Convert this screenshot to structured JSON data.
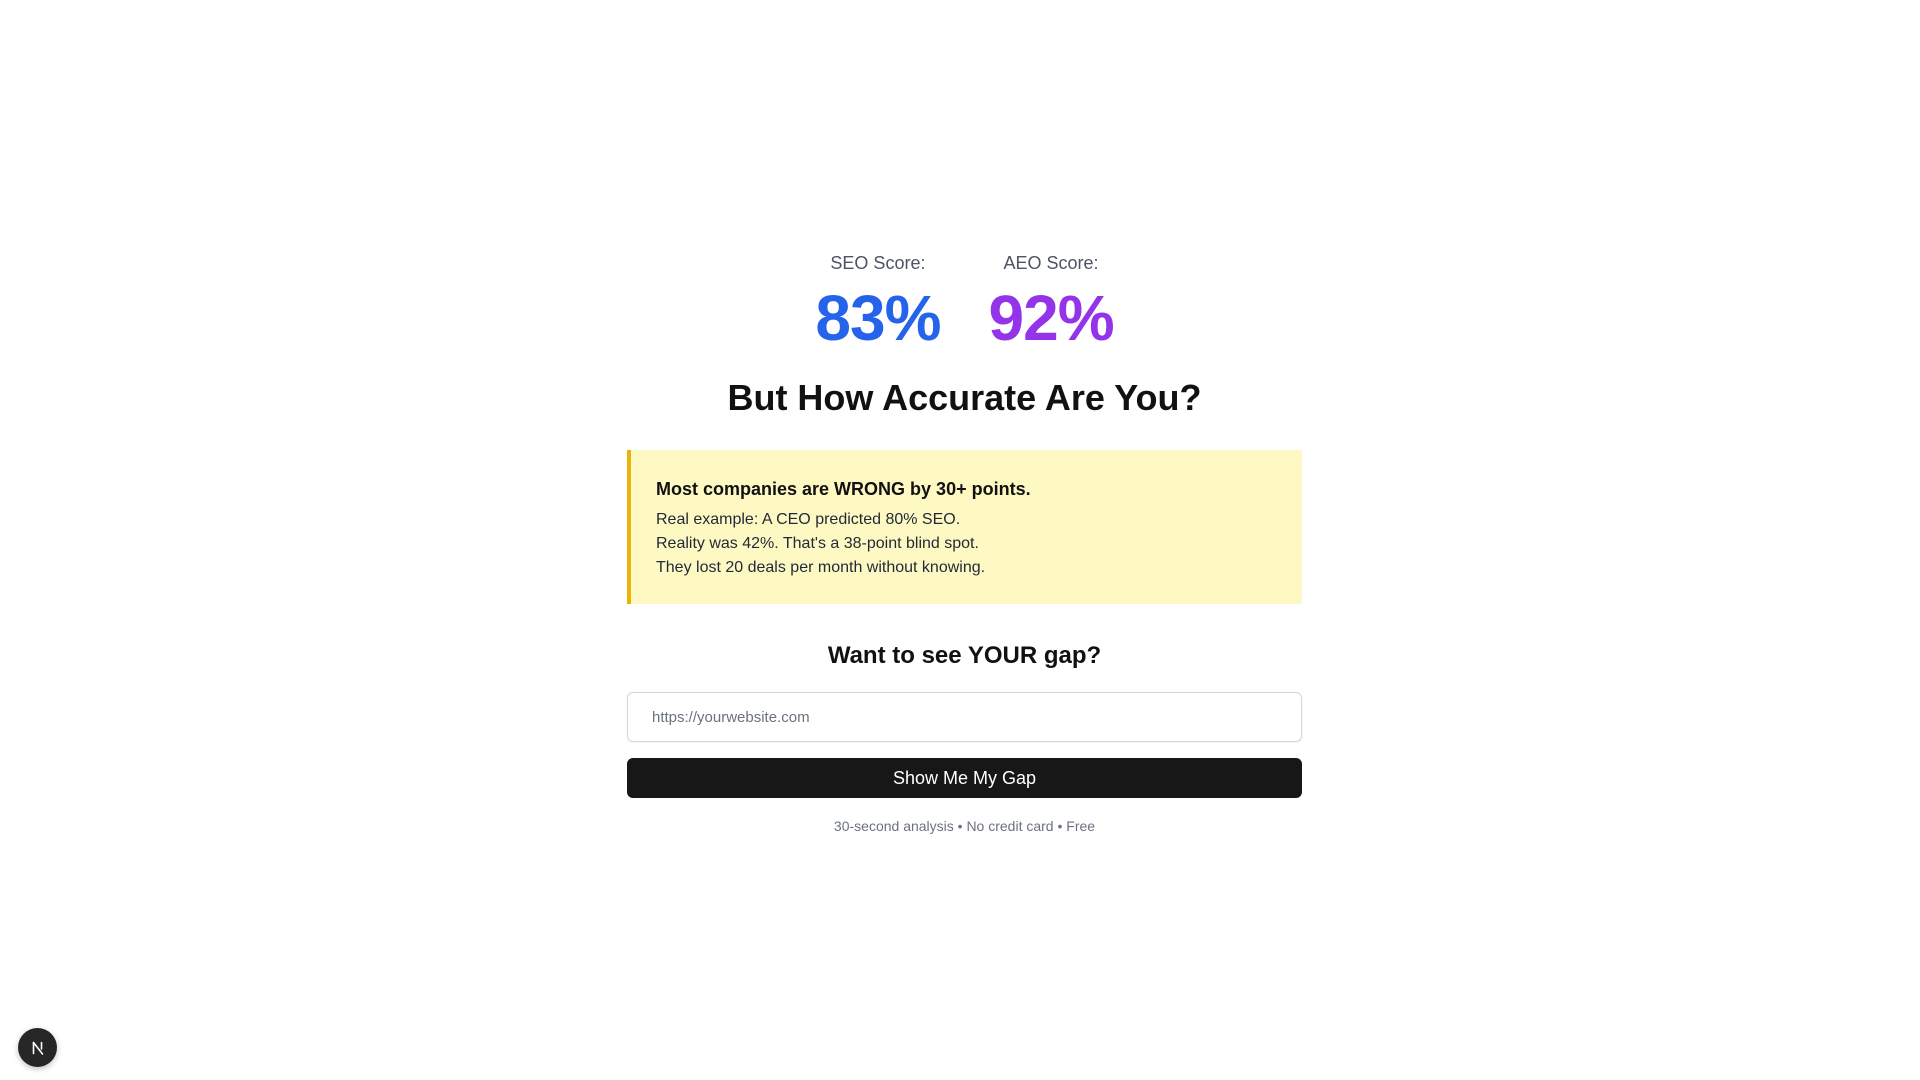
{
  "scores": {
    "seo": {
      "label": "SEO Score:",
      "value": "83%",
      "color": "#2563eb"
    },
    "aeo": {
      "label": "AEO Score:",
      "value": "92%",
      "color": "#9333ea"
    }
  },
  "headline": "But How Accurate Are You?",
  "callout": {
    "title": "Most companies are WRONG by 30+ points.",
    "lines": [
      "Real example: A CEO predicted 80% SEO.",
      "Reality was 42%. That's a 38-point blind spot.",
      "They lost 20 deals per month without knowing."
    ],
    "background": "#fef9c3",
    "accent": "#eab308"
  },
  "cta": {
    "heading": "Want to see YOUR gap?",
    "input_placeholder": "https://yourwebsite.com",
    "input_value": "",
    "button_label": "Show Me My Gap",
    "footnote": "30-second analysis • No credit card • Free"
  },
  "corner_badge": {
    "icon": "nextjs-logo-icon"
  }
}
